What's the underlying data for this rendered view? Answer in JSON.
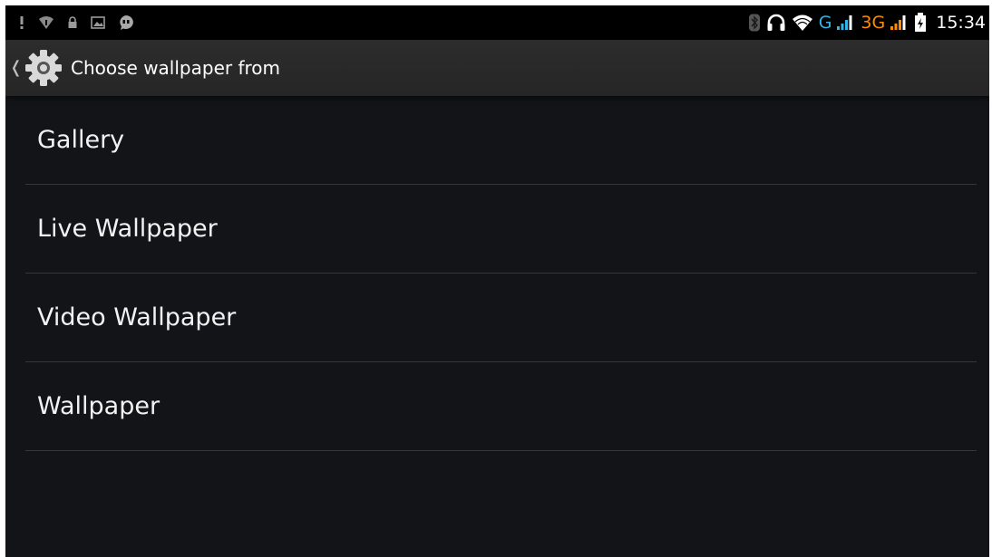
{
  "status_bar": {
    "left_icons": [
      "usb-debug-icon",
      "wifi-alert-icon",
      "lock-icon",
      "image-icon",
      "chat-icon"
    ],
    "right_icons": [
      "bluetooth-icon",
      "headset-icon",
      "wifi-icon"
    ],
    "network_type_1": "G",
    "network_type_2": "3G",
    "time": "15:34",
    "colors": {
      "network_1": "#33b5e5",
      "network_2": "#ff8a00"
    }
  },
  "action_bar": {
    "title": "Choose wallpaper from",
    "icon": "gear-icon"
  },
  "list": {
    "items": [
      {
        "label": "Gallery"
      },
      {
        "label": "Live Wallpaper"
      },
      {
        "label": "Video Wallpaper"
      },
      {
        "label": "Wallpaper"
      }
    ]
  }
}
